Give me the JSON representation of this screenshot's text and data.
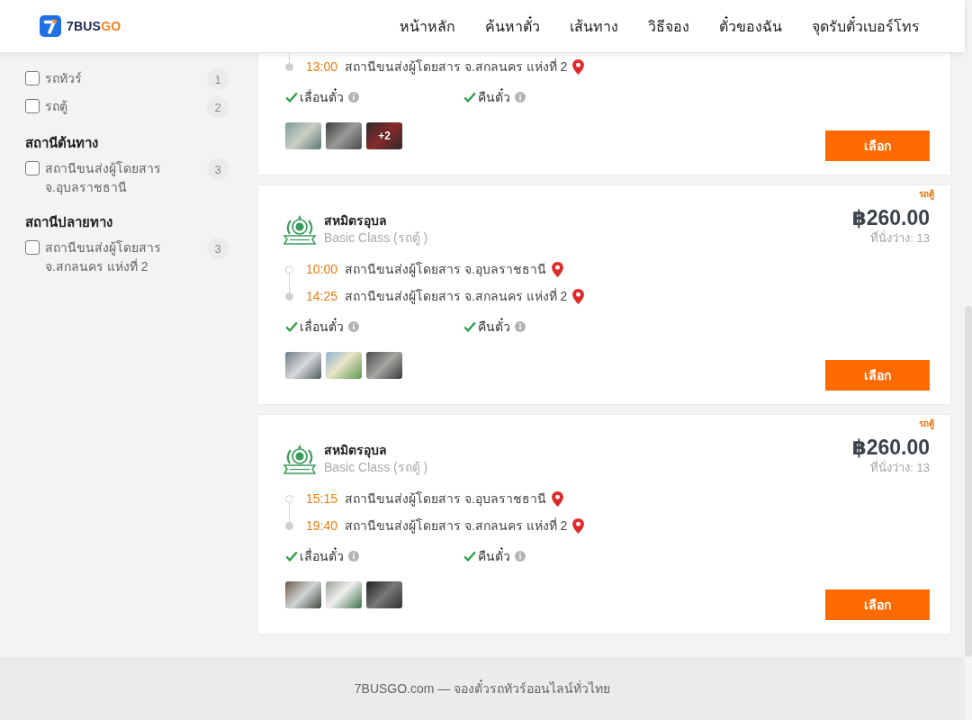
{
  "header": {
    "brand": {
      "name": "7BUS",
      "accent": "GO"
    },
    "nav": [
      {
        "label": "หน้าหลัก"
      },
      {
        "label": "ค้นหาตั๋ว"
      },
      {
        "label": "เส้นทาง"
      },
      {
        "label": "วิธีจอง"
      },
      {
        "label": "ตั๋วของฉัน"
      },
      {
        "label": "จุดรับตั๋วเบอร์โทร"
      }
    ]
  },
  "sidebar": {
    "groups": [
      {
        "options": [
          {
            "label": "รถทัวร์",
            "count": "1",
            "checked": false
          },
          {
            "label": "รถตู้",
            "count": "2",
            "checked": false
          }
        ]
      },
      {
        "title": "สถานีต้นทาง",
        "options": [
          {
            "label": "สถานีขนส่งผู้โดยสาร จ.อุบลราชธานี",
            "count": "3",
            "checked": false
          }
        ]
      },
      {
        "title": "สถานีปลายทาง",
        "options": [
          {
            "label": "สถานีขนส่งผู้โดยสาร จ.สกลนคร แห่งที่ 2",
            "count": "3",
            "checked": false
          }
        ]
      }
    ]
  },
  "trips": [
    {
      "stops": [
        {
          "kind": "arrival",
          "time": "13:00",
          "station": "สถานีขนส่งผู้โดยสาร จ.สกลนคร แห่งที่ 2"
        }
      ],
      "features": [
        {
          "label": "เลื่อนตั๋ว",
          "available": true
        },
        {
          "label": "คืนตั๋ว",
          "available": true
        }
      ],
      "photos": [
        {
          "kind": "photo"
        },
        {
          "kind": "photo"
        },
        {
          "kind": "more",
          "label": "+2"
        }
      ],
      "button": "เลือก"
    },
    {
      "tag": "รถตู้",
      "operator": "สหมิตรอุบล",
      "class": "Basic Class (รถตู้ )",
      "price": "฿260.00",
      "seats": "ที่นั่งว่าง: 13",
      "stops": [
        {
          "kind": "departure",
          "time": "10:00",
          "station": "สถานีขนส่งผู้โดยสาร จ.อุบลราชธานี"
        },
        {
          "kind": "arrival",
          "time": "14:25",
          "station": "สถานีขนส่งผู้โดยสาร จ.สกลนคร แห่งที่ 2"
        }
      ],
      "features": [
        {
          "label": "เลื่อนตั๋ว",
          "available": true
        },
        {
          "label": "คืนตั๋ว",
          "available": true
        }
      ],
      "photos": [
        {
          "kind": "photo"
        },
        {
          "kind": "photo"
        },
        {
          "kind": "photo"
        }
      ],
      "button": "เลือก"
    },
    {
      "tag": "รถตู้",
      "operator": "สหมิตรอุบล",
      "class": "Basic Class (รถตู้ )",
      "price": "฿260.00",
      "seats": "ที่นั่งว่าง: 13",
      "stops": [
        {
          "kind": "departure",
          "time": "15:15",
          "station": "สถานีขนส่งผู้โดยสาร จ.อุบลราชธานี"
        },
        {
          "kind": "arrival",
          "time": "19:40",
          "station": "สถานีขนส่งผู้โดยสาร จ.สกลนคร แห่งที่ 2"
        }
      ],
      "features": [
        {
          "label": "เลื่อนตั๋ว",
          "available": true
        },
        {
          "label": "คืนตั๋ว",
          "available": true
        }
      ],
      "photos": [
        {
          "kind": "photo"
        },
        {
          "kind": "photo"
        },
        {
          "kind": "photo"
        }
      ],
      "button": "เลือก"
    }
  ],
  "footer": {
    "text": "7BUSGO.com — จองตั๋วรถทัวร์ออนไลน์ทั่วไทย"
  }
}
